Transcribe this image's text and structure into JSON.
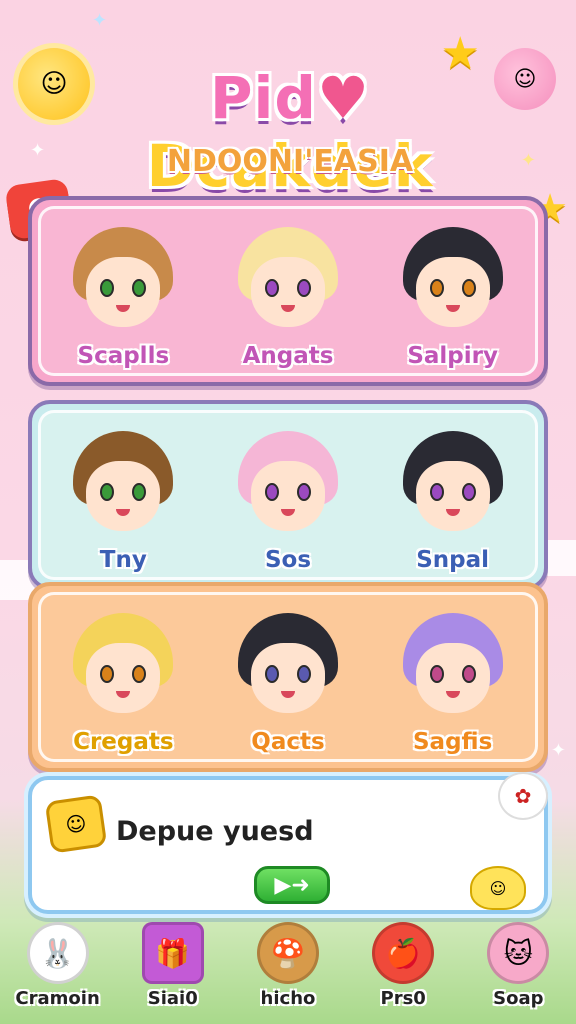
{
  "header": {
    "title_part1": "Pid",
    "title_part2": "Dcakdek",
    "subtitle": "NDOONI'EASIA",
    "icons": [
      "sun-icon",
      "star-icon",
      "pink-blob-icon",
      "heart-icon"
    ]
  },
  "panels": [
    {
      "characters": [
        {
          "name": "Scaplls",
          "hair": "#c88a4a",
          "eye": "#3a9a3a"
        },
        {
          "name": "Angats",
          "hair": "#f8e3a0",
          "eye": "#9b4ac0"
        },
        {
          "name": "Salpiry",
          "hair": "#2a2a33",
          "eye": "#d9821a"
        }
      ]
    },
    {
      "characters": [
        {
          "name": "Tny",
          "hair": "#8a5a2a",
          "eye": "#3a9a3a"
        },
        {
          "name": "Sos",
          "hair": "#f5b6d6",
          "eye": "#9b4ac0"
        },
        {
          "name": "Snpal",
          "hair": "#2a2a33",
          "eye": "#9b4ac0"
        }
      ]
    },
    {
      "characters": [
        {
          "name": "Cregats",
          "hair": "#f4d35a",
          "eye": "#d9821a"
        },
        {
          "name": "Qacts",
          "hair": "#2a2a33",
          "eye": "#5a5ab0"
        },
        {
          "name": "Sagfis",
          "hair": "#a98be6",
          "eye": "#c04a8a"
        }
      ]
    }
  ],
  "dialog": {
    "text": "Depue yuesd",
    "next_label": "▶➜"
  },
  "nav": [
    {
      "label": "Cramoin",
      "icon": "bunny-icon",
      "color": "#ffffff"
    },
    {
      "label": "Siai0",
      "icon": "gift-icon",
      "color": "#c35ad6"
    },
    {
      "label": "hicho",
      "icon": "mushroom-icon",
      "color": "#d79a4a"
    },
    {
      "label": "Prs0",
      "icon": "apple-icon",
      "color": "#f0493a"
    },
    {
      "label": "Soap",
      "icon": "pink-cat-icon",
      "color": "#f7a9c9"
    }
  ],
  "colors": {
    "panel1": "#f7a7cb",
    "panel2": "#c9ecee",
    "panel3": "#fcc28e",
    "accent_green": "#2fb034"
  }
}
